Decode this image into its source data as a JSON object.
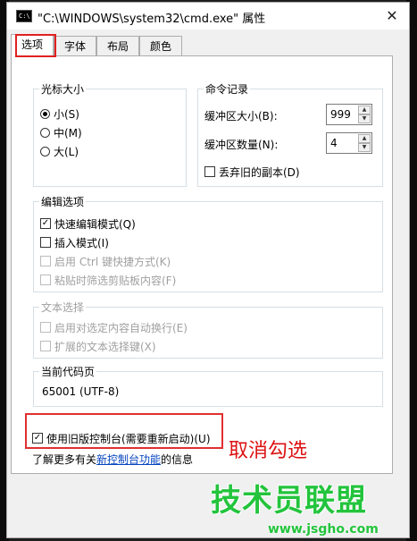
{
  "window": {
    "title": "\"C:\\WINDOWS\\system32\\cmd.exe\" 属性",
    "icon_text": "C:\\",
    "close_symbol": "✕"
  },
  "tabs": [
    {
      "label": "选项",
      "active": true
    },
    {
      "label": "字体",
      "active": false
    },
    {
      "label": "布局",
      "active": false
    },
    {
      "label": "颜色",
      "active": false
    }
  ],
  "cursor_size": {
    "title": "光标大小",
    "options": [
      {
        "label": "小(S)",
        "checked": true
      },
      {
        "label": "中(M)",
        "checked": false
      },
      {
        "label": "大(L)",
        "checked": false
      }
    ]
  },
  "command_history": {
    "title": "命令记录",
    "buffer_size_label": "缓冲区大小(B):",
    "buffer_size_value": "999",
    "buffer_count_label": "缓冲区数量(N):",
    "buffer_count_value": "4",
    "discard_label": "丢弃旧的副本(D)"
  },
  "edit_options": {
    "title": "编辑选项",
    "items": [
      {
        "label": "快速编辑模式(Q)",
        "checked": true,
        "disabled": false
      },
      {
        "label": "插入模式(I)",
        "checked": false,
        "disabled": false
      },
      {
        "label": "启用 Ctrl 键快捷方式(K)",
        "checked": false,
        "disabled": true
      },
      {
        "label": "粘贴时筛选剪贴板内容(F)",
        "checked": false,
        "disabled": true
      }
    ]
  },
  "text_selection": {
    "title": "文本选择",
    "items": [
      {
        "label": "启用对选定内容自动换行(E)",
        "disabled": true
      },
      {
        "label": "扩展的文本选择键(X)",
        "disabled": true
      }
    ]
  },
  "code_page": {
    "title": "当前代码页",
    "value": "65001 (UTF-8)"
  },
  "legacy": {
    "label": "使用旧版控制台(需要重新启动)(U)",
    "checked": true
  },
  "info": {
    "prefix": "了解更多有关",
    "link": "新控制台功能",
    "suffix": "的信息"
  },
  "annotation": "取消勾选",
  "watermark": {
    "text": "技术员联盟",
    "url": "www.jsgho.com"
  },
  "colors": {
    "highlight_red": "#e02020",
    "link_blue": "#0645c0",
    "watermark_green": "#23c43c"
  }
}
